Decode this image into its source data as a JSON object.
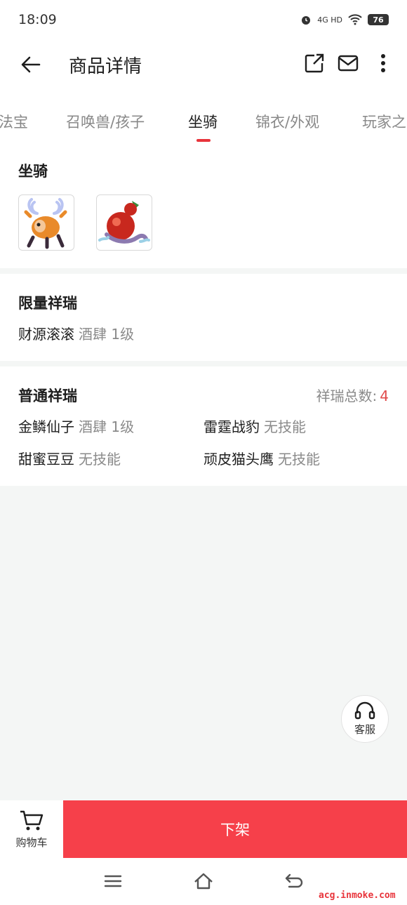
{
  "status_bar": {
    "time": "18:09",
    "network": "4G HD",
    "battery": "76"
  },
  "header": {
    "title": "商品详情"
  },
  "tabs": [
    {
      "label": "法宝"
    },
    {
      "label": "召唤兽/孩子"
    },
    {
      "label": "坐骑",
      "active": true
    },
    {
      "label": "锦衣/外观"
    },
    {
      "label": "玩家之"
    }
  ],
  "mounts_section": {
    "title": "坐骑",
    "thumbnails": [
      "deer-mount",
      "gourd-mount"
    ]
  },
  "limited_section": {
    "title": "限量祥瑞",
    "items": [
      {
        "name": "财源滚滚",
        "detail": "酒肆 1级"
      }
    ]
  },
  "normal_section": {
    "title": "普通祥瑞",
    "count_label": "祥瑞总数:",
    "count_value": "4",
    "items": [
      {
        "name": "金鳞仙子",
        "detail": "酒肆 1级"
      },
      {
        "name": "雷霆战豹",
        "detail": "无技能"
      },
      {
        "name": "甜蜜豆豆",
        "detail": "无技能"
      },
      {
        "name": "顽皮猫头鹰",
        "detail": "无技能"
      }
    ]
  },
  "customer_service": {
    "label": "客服"
  },
  "bottom_bar": {
    "cart_label": "购物车",
    "delist_label": "下架"
  },
  "watermark": "acg.inmoke.com",
  "colors": {
    "accent": "#f6404a",
    "indicator": "#e8343b",
    "count": "#e04a4a"
  }
}
